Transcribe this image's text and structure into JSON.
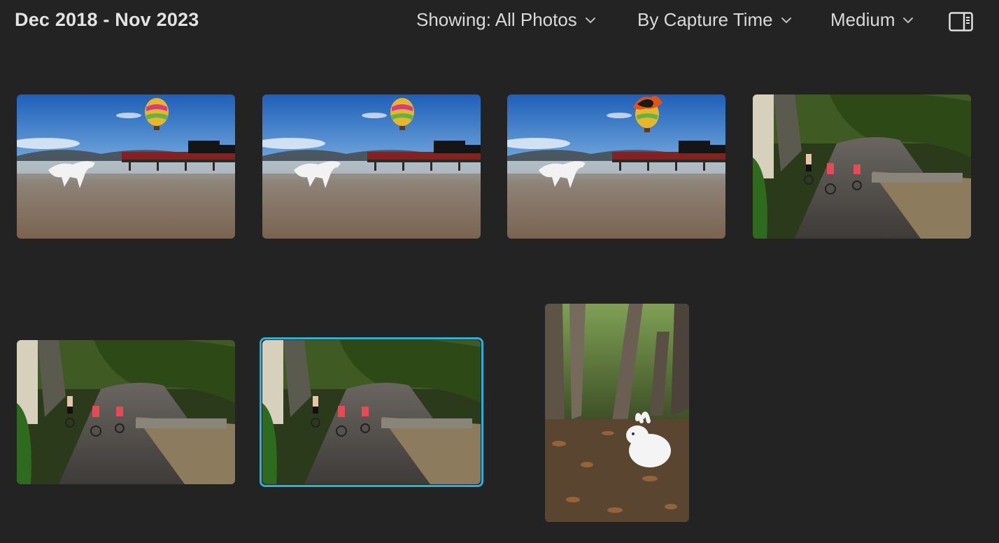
{
  "header": {
    "date_range": "Dec 2018 - Nov 2023",
    "filter_label": "Showing: All Photos",
    "sort_label": "By Capture Time",
    "size_label": "Medium",
    "panel_toggle_icon": "sidebar-panel-icon",
    "chevron_icon": "chevron-down-icon"
  },
  "colors": {
    "background": "#232323",
    "selection_accent": "#27b3d9",
    "text": "#e3e3e3"
  },
  "photos": [
    {
      "subject": "beach-horse-train-balloon",
      "selected": false
    },
    {
      "subject": "beach-horse-train-balloon",
      "selected": false
    },
    {
      "subject": "beach-horse-train-burning-balloon",
      "selected": false
    },
    {
      "subject": "kids-cycling-lane",
      "selected": false
    },
    {
      "subject": "kids-cycling-lane",
      "selected": false
    },
    {
      "subject": "kids-cycling-lane",
      "selected": true
    },
    {
      "subject": "rabbit-in-forest",
      "selected": false
    }
  ]
}
